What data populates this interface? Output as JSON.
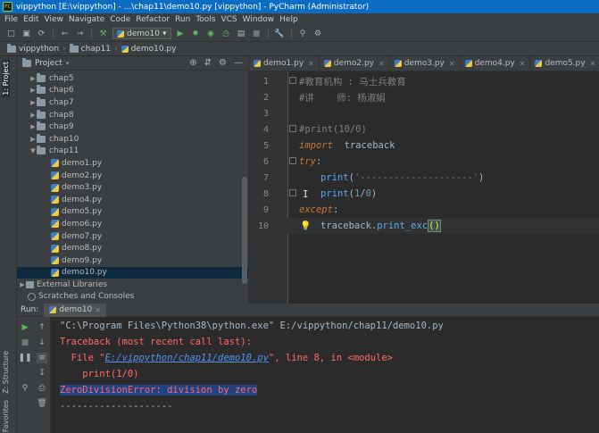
{
  "window": {
    "title": "vippython [E:\\vippython] - ...\\chap11\\demo10.py [vippython] - PyCharm (Administrator)"
  },
  "menu": [
    "File",
    "Edit",
    "View",
    "Navigate",
    "Code",
    "Refactor",
    "Run",
    "Tools",
    "VCS",
    "Window",
    "Help"
  ],
  "toolbar": {
    "run_config": "demo10"
  },
  "breadcrumb": [
    "vippython",
    "chap11",
    "demo10.py"
  ],
  "left_stripe": {
    "project": "1: Project",
    "structure": "Z: Structure",
    "favorites": "2: Favorites"
  },
  "project_panel": {
    "title": "Project",
    "folders_collapsed": [
      "chap5",
      "chap6",
      "chap7",
      "chap8",
      "chap9",
      "chap10"
    ],
    "open_folder": "chap11",
    "files": [
      "demo1.py",
      "demo2.py",
      "demo3.py",
      "demo4.py",
      "demo5.py",
      "demo6.py",
      "demo7.py",
      "demo8.py",
      "demo9.py",
      "demo10.py"
    ],
    "selected_file": "demo10.py",
    "external_libraries": "External Libraries",
    "scratches": "Scratches and Consoles"
  },
  "editor": {
    "tabs": [
      "demo1.py",
      "demo2.py",
      "demo3.py",
      "demo4.py",
      "demo5.py",
      "demo"
    ],
    "line_numbers": [
      "1",
      "2",
      "3",
      "4",
      "5",
      "6",
      "7",
      "8",
      "9",
      "10"
    ],
    "lines": {
      "l1": "#教育机构 : 马士兵教育",
      "l2": "#讲    师: 杨淑娟",
      "l4": "#print(10/0)",
      "l5_kw": "import",
      "l5_mod": "  traceback",
      "l6_kw": "try",
      "l6_colon": ":",
      "l7_fn": "print",
      "l7_open": "(",
      "l7_str": "'--------------------'",
      "l7_close": ")",
      "l8_fn": "print",
      "l8_open": "(",
      "l8_num1": "1",
      "l8_slash": "/",
      "l8_num2": "0",
      "l8_close": ")",
      "l9_kw": "except",
      "l9_colon": ":",
      "l10_obj": "traceback.",
      "l10_fn": "print_exc",
      "l10_paren": "()"
    }
  },
  "run_panel": {
    "label": "Run:",
    "tab": "demo10",
    "console": {
      "cmd": "\"C:\\Program Files\\Python38\\python.exe\" E:/vippython/chap11/demo10.py",
      "traceback": "Traceback (most recent call last):",
      "file_prefix": "  File \"",
      "file_link": "E:/vippython/chap11/demo10.py",
      "file_suffix": "\", line 8, in <module>",
      "code": "    print(1/0)",
      "error": "ZeroDivisionError: division by zero",
      "dashes": "--------------------"
    }
  },
  "colors": {
    "titlebar": "#0a6cc2",
    "selection": "#0d293e",
    "error": "#ff6b68",
    "link": "#5394ec"
  }
}
